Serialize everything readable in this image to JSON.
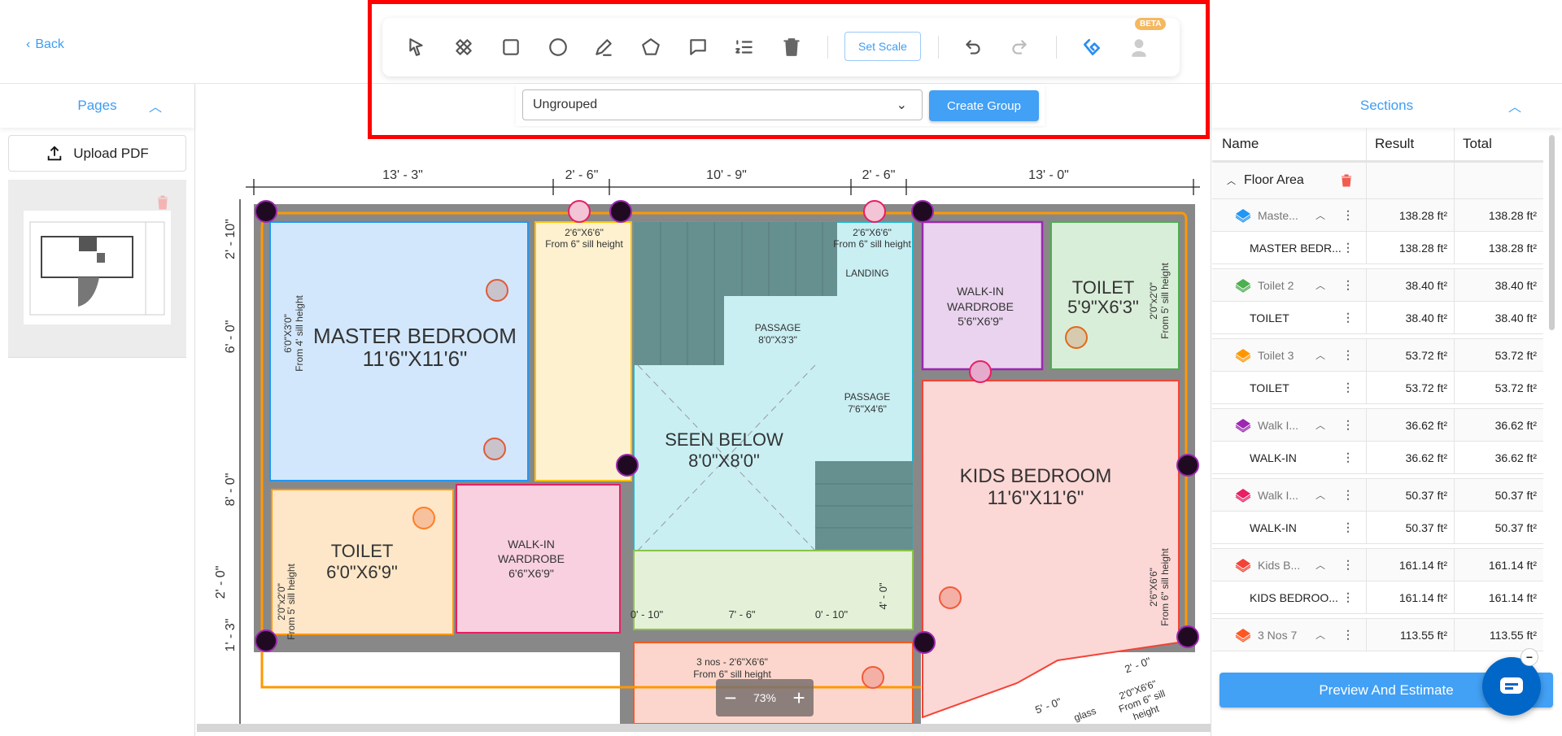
{
  "header": {
    "back_label": "Back"
  },
  "toolbar": {
    "tools": [
      "select-tool",
      "eraser-tool",
      "rectangle-tool",
      "circle-tool",
      "pen-tool",
      "polygon-tool",
      "comment-tool",
      "numbered-list-tool",
      "delete-tool"
    ],
    "set_scale_label": "Set Scale",
    "beta_label": "BETA",
    "group_select_value": "Ungrouped",
    "create_group_label": "Create Group"
  },
  "pages": {
    "title": "Pages",
    "upload_label": "Upload PDF"
  },
  "canvas": {
    "zoom_level": "73%"
  },
  "plan": {
    "dims_top": [
      "13' - 3\"",
      "2' - 6\"",
      "10' - 9\"",
      "2' - 6\"",
      "13' - 0\""
    ],
    "dims_left": [
      "2' - 10\"",
      "6' - 0\"",
      "8' - 0\"",
      "2' - 0\"",
      "1' - 3\""
    ],
    "dims_inner": [
      "0' - 10\"",
      "7' - 6\"",
      "0' - 10\"",
      "4' - 0\"",
      "5' - 0\"",
      "2' - 0\""
    ],
    "master_name": "MASTER BEDROOM",
    "master_size": "11'6\"X11'6\"",
    "master_window_1": "6'0\"X3'0\"",
    "master_window_2": "From 4' sill height",
    "door1_a": "2'6\"X6'6\"",
    "door1_b": "From 6\" sill height",
    "door2_a": "2'6\"X6'6\"",
    "door2_b": "From 6\" sill height",
    "landing": "LANDING",
    "passage1_name": "PASSAGE",
    "passage1_size": "8'0\"X3'3\"",
    "passage2_name": "PASSAGE",
    "passage2_size": "7'6\"X4'6\"",
    "seen_name": "SEEN BELOW",
    "seen_size": "8'0\"X8'0\"",
    "wiw1_a": "WALK-IN",
    "wiw1_b": "WARDROBE",
    "wiw1_c": "5'6\"X6'9\"",
    "toilet1_name": "TOILET",
    "toilet1_size": "5'9\"X6'3\"",
    "toilet1_win_a": "2'0\"x2'0\"",
    "toilet1_win_b": "From 5' sill height",
    "kids_name": "KIDS BEDROOM",
    "kids_size": "11'6\"X11'6\"",
    "kids_win_a": "2'6\"X6'6\"",
    "kids_win_b": "From 6\" sill height",
    "toilet2_name": "TOILET",
    "toilet2_size": "6'0\"X6'9\"",
    "toilet2_win_a": "2'0\"x2'0\"",
    "toilet2_win_b": "From 5' sill height",
    "wiw2_a": "WALK-IN",
    "wiw2_b": "WARDROBE",
    "wiw2_c": "6'6\"X6'9\"",
    "bottom_a": "3 nos - 2'6\"X6'6\"",
    "bottom_b": "From 6\" sill height",
    "diag_a": "2'0\"X6'6\"",
    "diag_b": "From 6\" sill",
    "diag_c": "height",
    "diag_d": "glass"
  },
  "sections": {
    "title": "Sections",
    "columns": [
      "Name",
      "Result",
      "Total"
    ],
    "group_name": "Floor Area",
    "items": [
      {
        "name": "Maste...",
        "color": "#2196f3",
        "result": "138.28 ft²",
        "total": "138.28 ft²",
        "sub": {
          "name": "MASTER BEDR...",
          "result": "138.28 ft²",
          "total": "138.28 ft²"
        }
      },
      {
        "name": "Toilet 2",
        "color": "#4caf50",
        "result": "38.40 ft²",
        "total": "38.40 ft²",
        "sub": {
          "name": "TOILET",
          "result": "38.40 ft²",
          "total": "38.40 ft²"
        }
      },
      {
        "name": "Toilet 3",
        "color": "#ff9800",
        "result": "53.72 ft²",
        "total": "53.72 ft²",
        "sub": {
          "name": "TOILET",
          "result": "53.72 ft²",
          "total": "53.72 ft²"
        }
      },
      {
        "name": "Walk I...",
        "color": "#9c27b0",
        "result": "36.62 ft²",
        "total": "36.62 ft²",
        "sub": {
          "name": "WALK-IN",
          "result": "36.62 ft²",
          "total": "36.62 ft²"
        }
      },
      {
        "name": "Walk I...",
        "color": "#e91e63",
        "result": "50.37 ft²",
        "total": "50.37 ft²",
        "sub": {
          "name": "WALK-IN",
          "result": "50.37 ft²",
          "total": "50.37 ft²"
        }
      },
      {
        "name": "Kids B...",
        "color": "#f44336",
        "result": "161.14 ft²",
        "total": "161.14 ft²",
        "sub": {
          "name": "KIDS BEDROO...",
          "result": "161.14 ft²",
          "total": "161.14 ft²"
        }
      },
      {
        "name": "3 Nos 7",
        "color": "#ff5722",
        "result": "113.55 ft²",
        "total": "113.55 ft²"
      }
    ],
    "preview_label": "Preview And Estimate"
  },
  "colors": {
    "accent": "#42a0f5",
    "highlight": "#ff0000"
  }
}
